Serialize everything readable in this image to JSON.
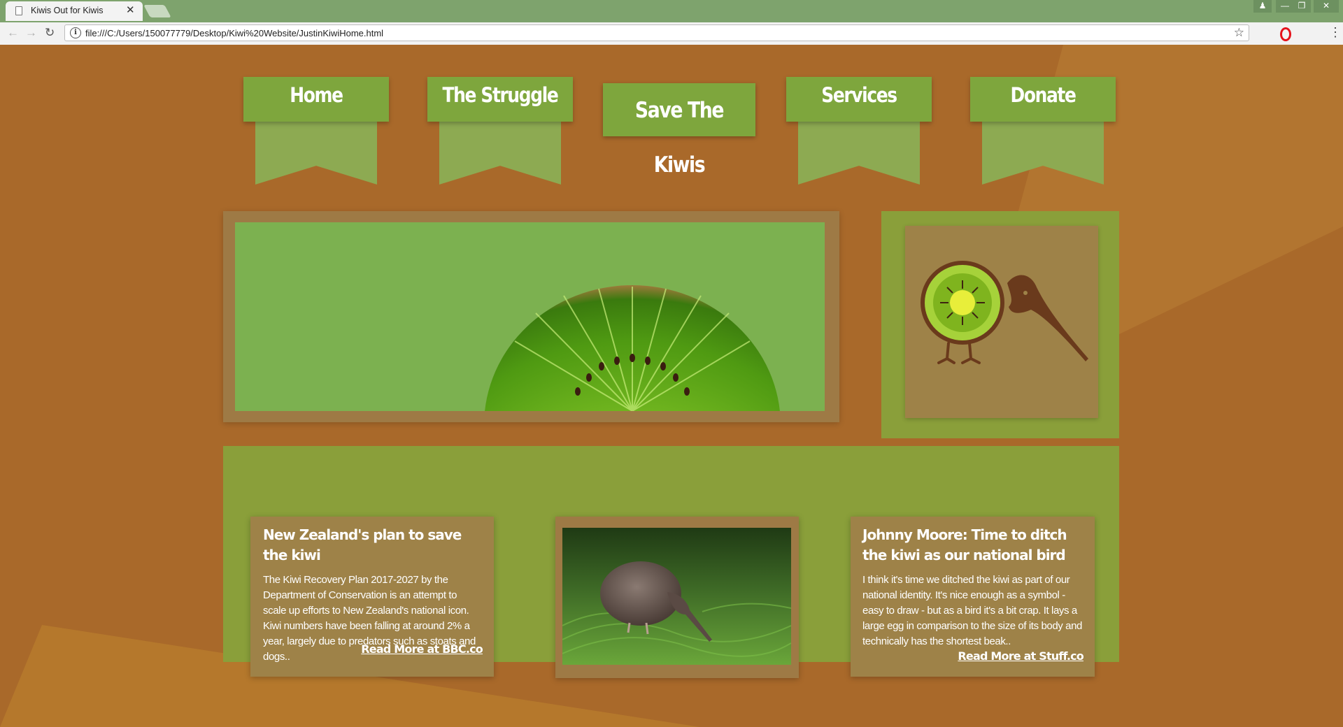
{
  "browser": {
    "tab_title": "Kiwis Out for Kiwis",
    "tab_close": "✕",
    "url": "file:///C:/Users/150077779/Desktop/Kiwi%20Website/JustinKiwiHome.html"
  },
  "nav": {
    "items": [
      {
        "label": "Home"
      },
      {
        "label": "The Struggle"
      },
      {
        "label": "Save The Kiwis"
      },
      {
        "label": "Services"
      },
      {
        "label": "Donate"
      }
    ]
  },
  "articles": {
    "left": {
      "title": "New Zealand's plan to save the kiwi",
      "body": "The Kiwi Recovery Plan 2017-2027 by the Department of Conservation is an attempt to scale up efforts to New Zealand's national icon. Kiwi numbers have been falling at around 2% a year, largely due to predators such as stoats and dogs..",
      "link": "Read More at BBC.co"
    },
    "right": {
      "title": "Johnny Moore: Time to ditch the kiwi as our national bird",
      "body": "I think it's time we ditched the kiwi as part of our national identity. It's nice enough as a symbol - easy to draw - but as a bird it's a bit crap. It lays a large egg in comparison to the size of its body and technically has the shortest beak..",
      "link": "Read More at Stuff.co"
    }
  },
  "colors": {
    "page_bg": "#a9692a",
    "nav_green": "#7ea63d",
    "panel_green": "#8a9f3a",
    "card_brown": "#9e8248"
  },
  "icons": [
    "document-icon",
    "close-icon",
    "back-icon",
    "forward-icon",
    "reload-icon",
    "info-icon",
    "star-icon",
    "opera-icon",
    "menu-icon",
    "kiwi-logo",
    "kiwi-fruit-image",
    "kiwi-bird-photo"
  ]
}
